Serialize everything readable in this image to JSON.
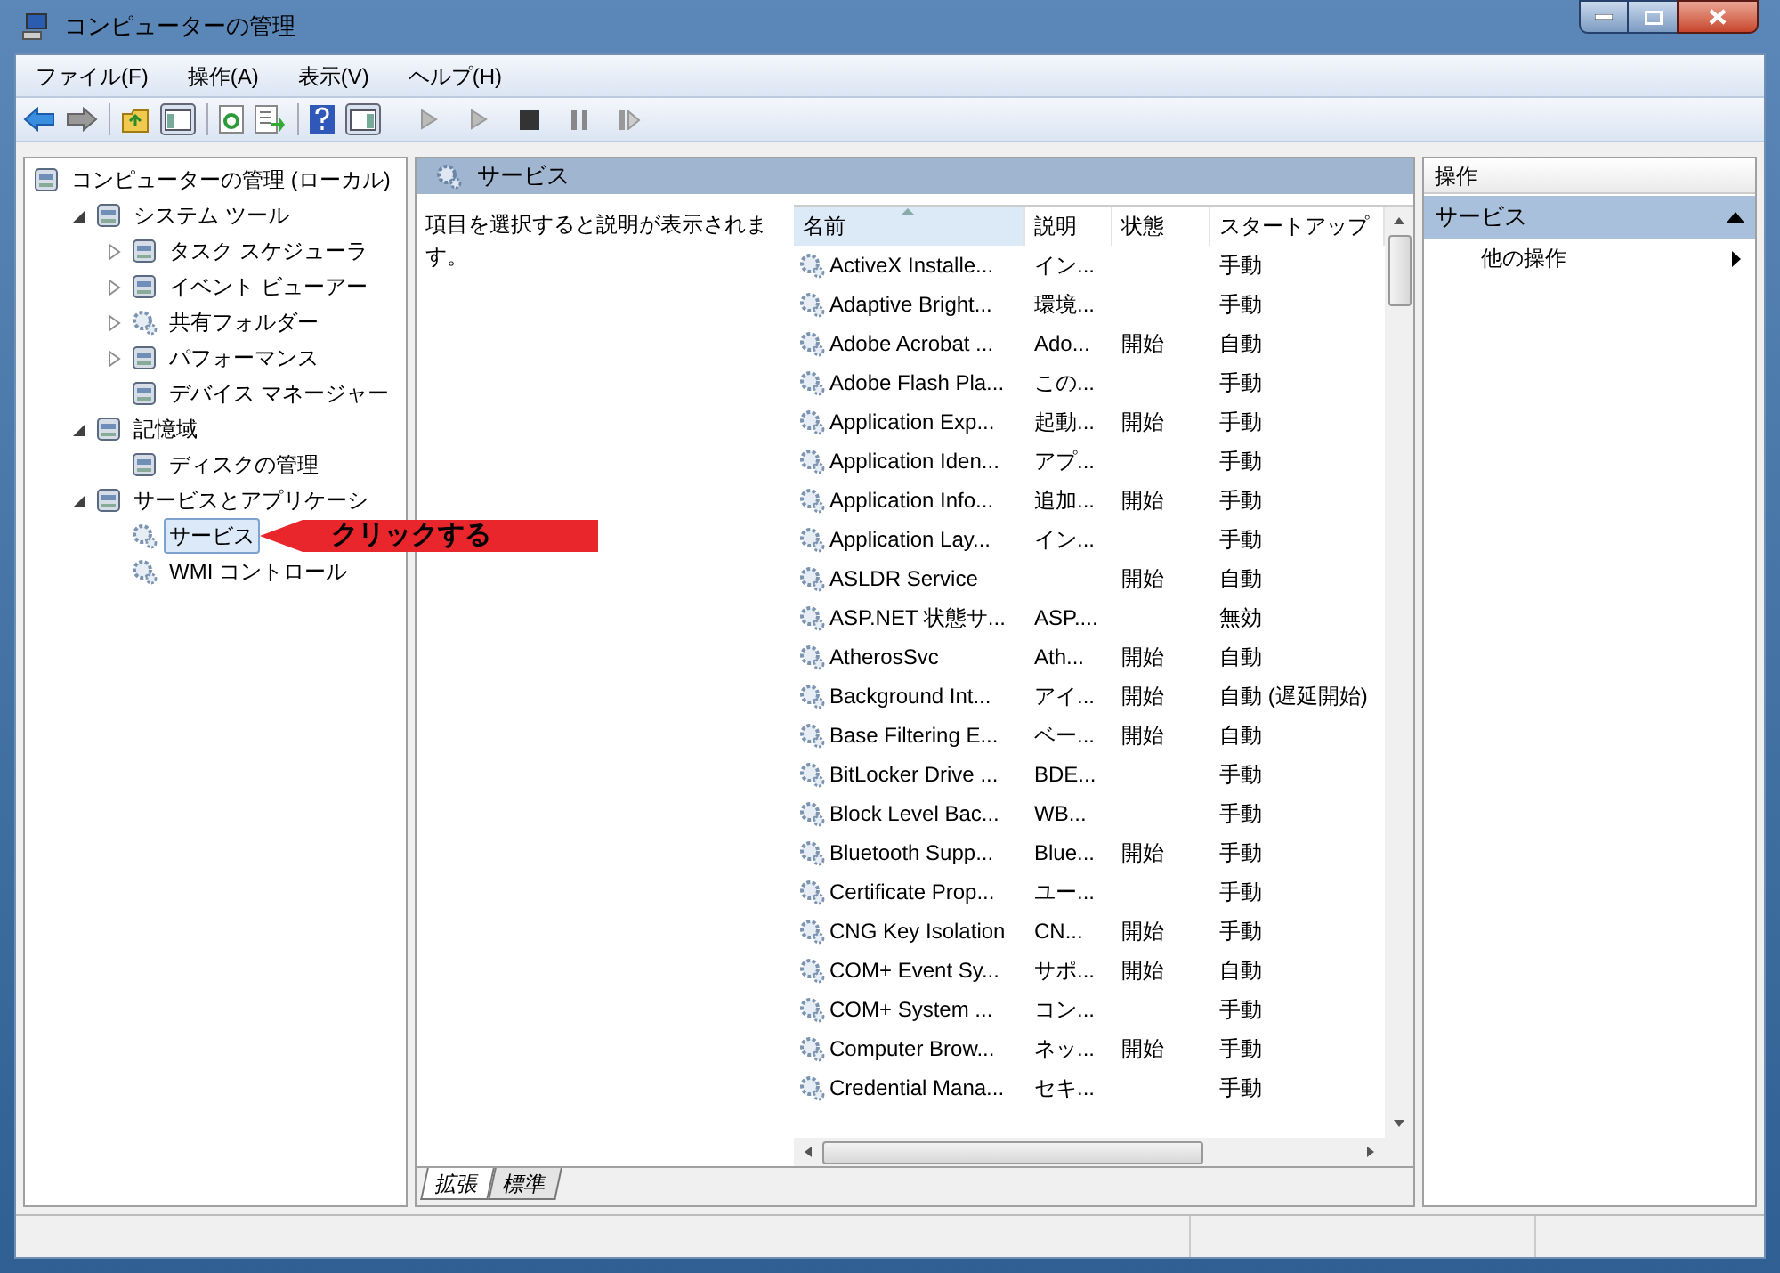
{
  "window": {
    "title": "コンピューターの管理"
  },
  "menu": [
    "ファイル(F)",
    "操作(A)",
    "表示(V)",
    "ヘルプ(H)"
  ],
  "tree": {
    "label": "コンピューターの管理 (ローカル)",
    "selected": false,
    "children": [
      {
        "label": "システム ツール",
        "expanded": true,
        "selected": false,
        "children": [
          {
            "label": "タスク スケジューラ",
            "expanded": false,
            "selected": false
          },
          {
            "label": "イベント ビューアー",
            "expanded": false,
            "selected": false
          },
          {
            "label": "共有フォルダー",
            "expanded": false,
            "selected": false
          },
          {
            "label": "パフォーマンス",
            "expanded": false,
            "selected": false
          },
          {
            "label": "デバイス マネージャー",
            "selected": false
          }
        ]
      },
      {
        "label": "記憶域",
        "expanded": true,
        "selected": false,
        "children": [
          {
            "label": "ディスクの管理",
            "selected": false
          }
        ]
      },
      {
        "label": "サービスとアプリケーシ",
        "expanded": true,
        "selected": false,
        "children": [
          {
            "label": "サービス",
            "selected": true
          },
          {
            "label": "WMI コントロール",
            "selected": false
          }
        ]
      }
    ]
  },
  "callout": {
    "text": "クリックする"
  },
  "center": {
    "title": "サービス",
    "description": "項目を選択すると説明が表示されます。",
    "columns": [
      "名前",
      "説明",
      "状態",
      "スタートアップ"
    ],
    "rows": [
      [
        "ActiveX Installe...",
        "イン...",
        "",
        "手動"
      ],
      [
        "Adaptive Bright...",
        "環境...",
        "",
        "手動"
      ],
      [
        "Adobe Acrobat ...",
        "Ado...",
        "開始",
        "自動"
      ],
      [
        "Adobe Flash Pla...",
        "この...",
        "",
        "手動"
      ],
      [
        "Application Exp...",
        "起動...",
        "開始",
        "手動"
      ],
      [
        "Application Iden...",
        "アプ...",
        "",
        "手動"
      ],
      [
        "Application Info...",
        "追加...",
        "開始",
        "手動"
      ],
      [
        "Application Lay...",
        "イン...",
        "",
        "手動"
      ],
      [
        "ASLDR Service",
        "",
        "開始",
        "自動"
      ],
      [
        "ASP.NET 状態サ...",
        "ASP....",
        "",
        "無効"
      ],
      [
        "AtherosSvc",
        "Ath...",
        "開始",
        "自動"
      ],
      [
        "Background Int...",
        "アイ...",
        "開始",
        "自動 (遅延開始)"
      ],
      [
        "Base Filtering E...",
        "ベー...",
        "開始",
        "自動"
      ],
      [
        "BitLocker Drive ...",
        "BDE...",
        "",
        "手動"
      ],
      [
        "Block Level Bac...",
        "WB...",
        "",
        "手動"
      ],
      [
        "Bluetooth Supp...",
        "Blue...",
        "開始",
        "手動"
      ],
      [
        "Certificate Prop...",
        "ユー...",
        "",
        "手動"
      ],
      [
        "CNG Key Isolation",
        "CN...",
        "開始",
        "手動"
      ],
      [
        "COM+ Event Sy...",
        "サポ...",
        "開始",
        "自動"
      ],
      [
        "COM+ System ...",
        "コン...",
        "",
        "手動"
      ],
      [
        "Computer Brow...",
        "ネッ...",
        "開始",
        "手動"
      ],
      [
        "Credential Mana...",
        "セキ...",
        "",
        "手動"
      ]
    ],
    "tabs": [
      {
        "label": "拡張",
        "selected": true
      },
      {
        "label": "標準",
        "selected": false
      }
    ]
  },
  "actions": {
    "title": "操作",
    "section": "サービス",
    "items": [
      "他の操作"
    ]
  }
}
